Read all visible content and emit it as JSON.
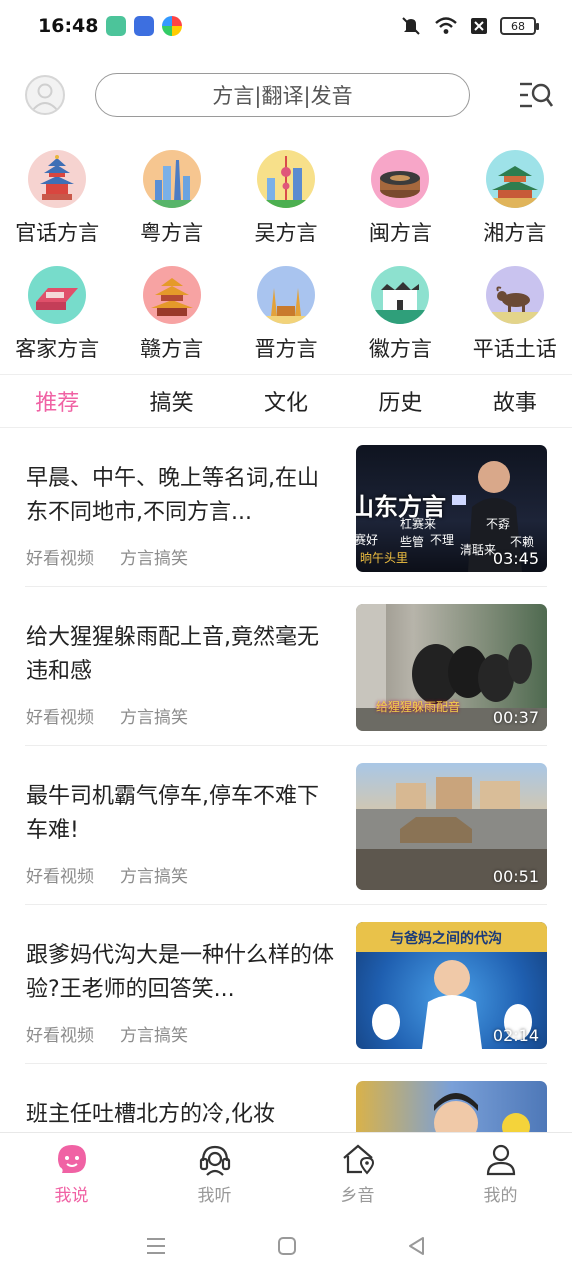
{
  "status_bar": {
    "time": "16:48",
    "battery": "68"
  },
  "header": {
    "search_placeholder": "方言|翻译|发音"
  },
  "dialects": [
    {
      "label": "官话方言",
      "color": "#f6d3d0"
    },
    {
      "label": "粤方言",
      "color": "#f6c690"
    },
    {
      "label": "吴方言",
      "color": "#f7e08a"
    },
    {
      "label": "闽方言",
      "color": "#f7a6c8"
    },
    {
      "label": "湘方言",
      "color": "#9ee2e8"
    },
    {
      "label": "客家方言",
      "color": "#77dccb"
    },
    {
      "label": "赣方言",
      "color": "#f7a3a3"
    },
    {
      "label": "晋方言",
      "color": "#a9c4ef"
    },
    {
      "label": "徽方言",
      "color": "#8de1cf"
    },
    {
      "label": "平话土话",
      "color": "#c9c3ef"
    }
  ],
  "tabs": [
    {
      "label": "推荐",
      "active": true
    },
    {
      "label": "搞笑",
      "active": false
    },
    {
      "label": "文化",
      "active": false
    },
    {
      "label": "历史",
      "active": false
    },
    {
      "label": "故事",
      "active": false
    }
  ],
  "feed": [
    {
      "title": "早晨、中午、晚上等名词,在山东不同地市,不同方言...",
      "source": "好看视频",
      "category": "方言搞笑",
      "duration": "03:45"
    },
    {
      "title": "给大猩猩躲雨配上音,竟然毫无违和感",
      "source": "好看视频",
      "category": "方言搞笑",
      "duration": "00:37"
    },
    {
      "title": "最牛司机霸气停车,停车不难下车难!",
      "source": "好看视频",
      "category": "方言搞笑",
      "duration": "00:51"
    },
    {
      "title": "跟爹妈代沟大是一种什么样的体验?王老师的回答笑...",
      "source": "好看视频",
      "category": "方言搞笑",
      "duration": "02:14"
    },
    {
      "title": "班主任吐槽北方的冷,化妆",
      "source": "",
      "category": "",
      "duration": ""
    }
  ],
  "bottom_nav": [
    {
      "label": "我说",
      "icon": "speech-face-icon",
      "active": true
    },
    {
      "label": "我听",
      "icon": "headset-icon",
      "active": false
    },
    {
      "label": "乡音",
      "icon": "home-location-icon",
      "active": false
    },
    {
      "label": "我的",
      "icon": "person-icon",
      "active": false
    }
  ],
  "thumbnail_text": {
    "t1_big": "山东方言",
    "t1_a": "杠赛来",
    "t1_b": "不孬",
    "t1_c": "赛好",
    "t1_d": "些管",
    "t1_e": "不理",
    "t1_f": "清聒来",
    "t1_g": "不赖",
    "t1_h": "晌午头里",
    "t2_caption": "给猩猩躲雨配音",
    "t4_banner": "与爸妈之间的代沟"
  }
}
